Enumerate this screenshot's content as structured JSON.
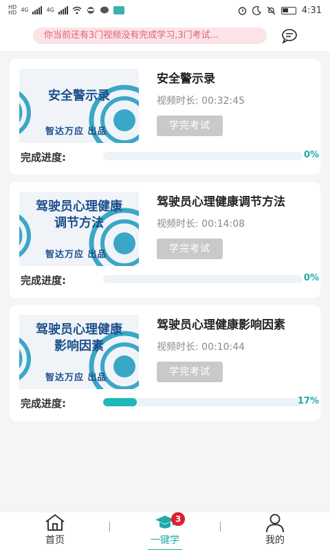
{
  "status_bar": {
    "network_a": "HD",
    "network_b": "HD",
    "signal_a": "4G",
    "signal_b": "4G",
    "time": "4:31"
  },
  "notice": {
    "text": "你当前还有3门视频没有完成学习,3门考试..."
  },
  "courses": [
    {
      "thumb_lines": [
        "安全警示录"
      ],
      "thumb_sub": "智达万应  出品",
      "title": "安全警示录",
      "duration_label": "视频时长:",
      "duration": "00:32:45",
      "exam_button": "学完考试",
      "progress_label": "完成进度:",
      "progress_value": 0,
      "progress_text": "0%"
    },
    {
      "thumb_lines": [
        "驾驶员心理健康",
        "调节方法"
      ],
      "thumb_sub": "智达万应  出品",
      "title": "驾驶员心理健康调节方法",
      "duration_label": "视频时长:",
      "duration": "00:14:08",
      "exam_button": "学完考试",
      "progress_label": "完成进度:",
      "progress_value": 0,
      "progress_text": "0%"
    },
    {
      "thumb_lines": [
        "驾驶员心理健康",
        "影响因素"
      ],
      "thumb_sub": "智达万应  出品",
      "title": "驾驶员心理健康影响因素",
      "duration_label": "视频时长:",
      "duration": "00:10:44",
      "exam_button": "学完考试",
      "progress_label": "完成进度:",
      "progress_value": 17,
      "progress_text": "17%"
    }
  ],
  "bottom_nav": {
    "home_label": "首页",
    "learn_label": "一键学",
    "learn_badge": "3",
    "me_label": "我的"
  },
  "colors": {
    "accent": "#1fa9a9",
    "notice_bg": "#fbe3e6",
    "notice_text": "#e0607a",
    "badge": "#e0202a",
    "thumb_title": "#1c4f8c"
  }
}
